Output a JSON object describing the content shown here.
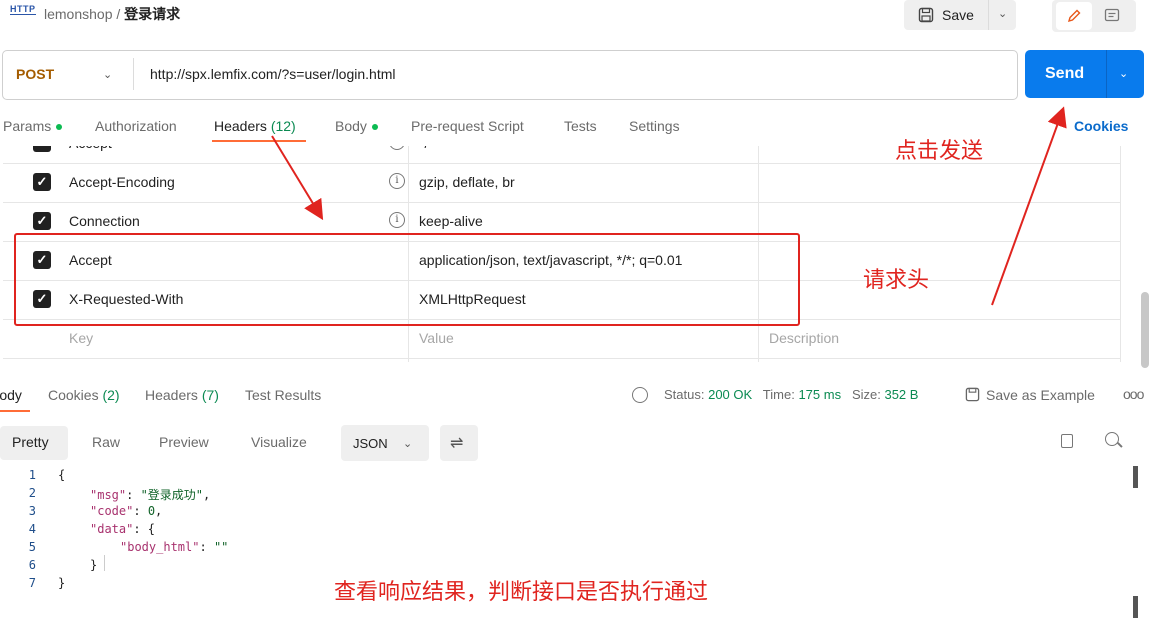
{
  "breadcrumb": {
    "icon": "HTTP",
    "workspace": "lemonshop",
    "sep": "/",
    "name": "登录请求"
  },
  "toolbar": {
    "save_label": "Save"
  },
  "request": {
    "method": "POST",
    "url": "http://spx.lemfix.com/?s=user/login.html",
    "send_label": "Send"
  },
  "tabs": [
    {
      "label": "Params",
      "count": ""
    },
    {
      "label": "Authorization",
      "count": ""
    },
    {
      "label": "Headers",
      "count": "(12)"
    },
    {
      "label": "Body",
      "count": ""
    },
    {
      "label": "Pre-request Script",
      "count": ""
    },
    {
      "label": "Tests",
      "count": ""
    },
    {
      "label": "Settings",
      "count": ""
    }
  ],
  "cookies_link": "Cookies",
  "headers": [
    {
      "key": "Accept",
      "value": "*/*",
      "desc": ""
    },
    {
      "key": "Accept-Encoding",
      "value": "gzip, deflate, br",
      "desc": ""
    },
    {
      "key": "Connection",
      "value": "keep-alive",
      "desc": ""
    },
    {
      "key": "Accept",
      "value": "application/json, text/javascript, */*; q=0.01",
      "desc": ""
    },
    {
      "key": "X-Requested-With",
      "value": "XMLHttpRequest",
      "desc": ""
    }
  ],
  "placeholders": {
    "key": "Key",
    "value": "Value",
    "desc": "Description"
  },
  "response_tabs": [
    {
      "label": "Body",
      "count": ""
    },
    {
      "label": "Cookies",
      "count": "(2)"
    },
    {
      "label": "Headers",
      "count": "(7)"
    },
    {
      "label": "Test Results",
      "count": ""
    }
  ],
  "status": {
    "status_label": "Status:",
    "status": "200 OK",
    "time_label": "Time:",
    "time": "175 ms",
    "size_label": "Size:",
    "size": "352 B"
  },
  "save_example": "Save as Example",
  "view_tabs": [
    "Pretty",
    "Raw",
    "Preview",
    "Visualize"
  ],
  "format": "JSON",
  "code_lines": [
    "1",
    "2",
    "3",
    "4",
    "5",
    "6",
    "7"
  ],
  "code": {
    "msg_key": "\"msg\"",
    "msg_val": "\"登录成功\"",
    "code_key": "\"code\"",
    "code_val": "0",
    "data_key": "\"data\"",
    "body_key": "\"body_html\"",
    "body_val": "\"\""
  },
  "annotations": {
    "send": "点击发送",
    "headers": "请求头",
    "result": "查看响应结果，判断接口是否执行通过"
  },
  "colors": {
    "accent": "#ff6c37",
    "send": "#097bed",
    "annotation": "#e0241f",
    "success": "#0b8a52"
  }
}
